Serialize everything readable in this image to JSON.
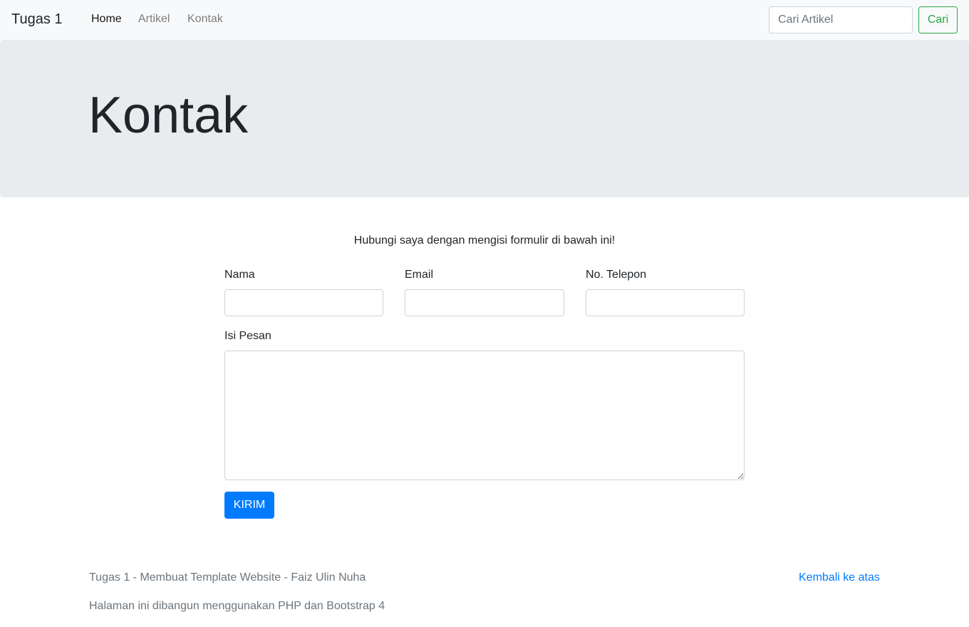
{
  "navbar": {
    "brand": "Tugas 1",
    "links": [
      {
        "label": "Home",
        "active": true
      },
      {
        "label": "Artikel",
        "active": false
      },
      {
        "label": "Kontak",
        "active": false
      }
    ],
    "search": {
      "placeholder": "Cari Artikel",
      "value": "",
      "button_label": "Cari"
    }
  },
  "jumbotron": {
    "title": "Kontak"
  },
  "contact": {
    "intro": "Hubungi saya dengan mengisi formulir di bawah ini!",
    "fields": {
      "name": {
        "label": "Nama",
        "value": ""
      },
      "email": {
        "label": "Email",
        "value": ""
      },
      "phone": {
        "label": "No. Telepon",
        "value": ""
      },
      "message": {
        "label": "Isi Pesan",
        "value": ""
      }
    },
    "submit_label": "KIRIM"
  },
  "footer": {
    "credit": "Tugas 1 - Membuat Template Website - Faiz Ulin Nuha",
    "back_to_top": "Kembali ke atas",
    "built_with": "Halaman ini dibangun menggunakan PHP dan Bootstrap 4"
  },
  "colors": {
    "navbar_bg": "#f8f9fa",
    "jumbotron_bg": "#e9ecef",
    "primary": "#007bff",
    "success": "#28a745",
    "muted": "#6c757d"
  }
}
